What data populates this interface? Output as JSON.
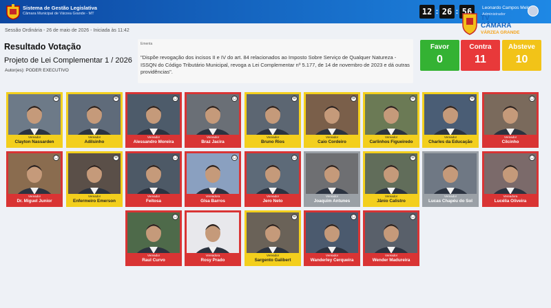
{
  "header": {
    "system_title": "Sistema de Gestão Legislativa",
    "system_subtitle": "Câmara Municipal de Várzea Grande - MT",
    "clock": {
      "hours": "12",
      "minutes": "26",
      "seconds": "56"
    },
    "user_name": "Leonardo Campos Melo",
    "user_role": "Administrador"
  },
  "tv": {
    "line1": "TV",
    "line2": "CÂMARA",
    "line3": "VÁRZEA GRANDE"
  },
  "session": {
    "info": "Sessão Ordinária - 26 de maio de 2026 - Iniciada às 11:42"
  },
  "main": {
    "title": "Resultado Votação",
    "project": "Projeto de Lei Complementar 1 / 2026",
    "author": "Autor(es): PODER EXECUTIVO",
    "ementa_label": "Ementa",
    "ementa_text": "\"Dispõe revogação dos incisos II e IV do art. 84 relacionados ao Imposto Sobre Serviço de Qualquer Natureza - ISSQN do Código Tributário Municipal, revoga a Lei Complementar nº 5.177, de 14 de novembro de 2023 e dá outras providências\"."
  },
  "votes": {
    "favor": {
      "label": "Favor",
      "count": "0",
      "color": "#34b233"
    },
    "contra": {
      "label": "Contra",
      "count": "11",
      "color": "#e8393a"
    },
    "abstem": {
      "label": "Absteve",
      "count": "10",
      "color": "#f2c318"
    }
  },
  "councilors": [
    {
      "role": "Vereador",
      "name": "Clayton Nassarden",
      "status": "abs",
      "badge": "⊖",
      "bg": "#6d7a88"
    },
    {
      "role": "Vereador",
      "name": "Adilsinho",
      "status": "abs",
      "badge": "⊖",
      "bg": "#5f6b7a"
    },
    {
      "role": "Vereador",
      "name": "Alessandro Moreira",
      "status": "no",
      "badge": "▢",
      "bg": "#4d5b6a"
    },
    {
      "role": "Vereador",
      "name": "Braz Jacira",
      "status": "no",
      "badge": "▢",
      "bg": "#6a6f76"
    },
    {
      "role": "Vereador",
      "name": "Bruno Rios",
      "status": "abs",
      "badge": "⊖",
      "bg": "#5c6672"
    },
    {
      "role": "Vereador",
      "name": "Caio Cordeiro",
      "status": "abs",
      "badge": "⊖",
      "bg": "#7a5f4a"
    },
    {
      "role": "Vereador",
      "name": "Carlinhos Figueiredo",
      "status": "abs",
      "badge": "⊖",
      "bg": "#6b7a55"
    },
    {
      "role": "Vereador",
      "name": "Charles da Educação",
      "status": "abs",
      "badge": "⊖",
      "bg": "#4a5d75"
    },
    {
      "role": "Vereador",
      "name": "Cilcinho",
      "status": "no",
      "badge": "▢",
      "bg": "#7a6a5c"
    },
    {
      "role": "Vereador",
      "name": "Dr. Miguel Junior",
      "status": "no",
      "badge": "▢",
      "bg": "#8a6c4f"
    },
    {
      "role": "Vereador",
      "name": "Enfermeiro Emerson",
      "status": "abs",
      "badge": "⊖",
      "bg": "#5a4f48"
    },
    {
      "role": "Vereador",
      "name": "Feitosa",
      "status": "no",
      "badge": "▢",
      "bg": "#4d5966"
    },
    {
      "role": "Vereadora",
      "name": "Glsa Barros",
      "status": "no",
      "badge": "▢",
      "bg": "#8aa0c0"
    },
    {
      "role": "Vereador",
      "name": "Jero Neto",
      "status": "no",
      "badge": "▢",
      "bg": "#5d6a78"
    },
    {
      "role": "Vereador",
      "name": "Joaquim Antunes",
      "status": "absent",
      "badge": "",
      "bg": "#6e6f72"
    },
    {
      "role": "Vereador",
      "name": "Jânio Calistro",
      "status": "abs",
      "badge": "⊖",
      "bg": "#616d5a"
    },
    {
      "role": "Vereador",
      "name": "Lucas Chapéu do Sol",
      "status": "absent",
      "badge": "",
      "bg": "#6f7884"
    },
    {
      "role": "Vereadora",
      "name": "Lucélia Oliveira",
      "status": "no",
      "badge": "▢",
      "bg": "#7b6a6a"
    },
    {
      "role": "Vereador",
      "name": "Raul Curvo",
      "status": "no",
      "badge": "▢",
      "bg": "#4e6a4a"
    },
    {
      "role": "Vereadora",
      "name": "Rosy Prado",
      "status": "no",
      "badge": "",
      "bg": "#e8e8ec"
    },
    {
      "role": "Vereador",
      "name": "Sargento Galibert",
      "status": "abs",
      "badge": "⊖",
      "bg": "#6a6258"
    },
    {
      "role": "Vereador",
      "name": "Wanderley Cerqueira",
      "status": "no",
      "badge": "▢",
      "bg": "#4b5a6e"
    },
    {
      "role": "Vereador",
      "name": "Wender Madureira",
      "status": "no",
      "badge": "▢",
      "bg": "#59606a"
    }
  ]
}
